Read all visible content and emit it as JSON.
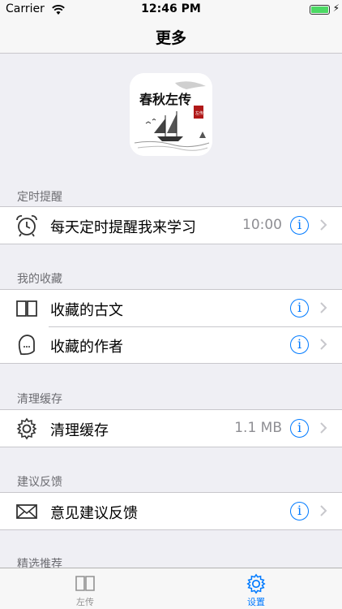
{
  "status": {
    "carrier": "Carrier",
    "time": "12:46 PM"
  },
  "nav": {
    "title": "更多"
  },
  "logo": {
    "text": "春秋左传",
    "stamp": "左传"
  },
  "sections": {
    "reminder": {
      "header": "定时提醒",
      "label": "每天定时提醒我来学习",
      "value": "10:00"
    },
    "favorites": {
      "header": "我的收藏",
      "items": [
        {
          "label": "收藏的古文"
        },
        {
          "label": "收藏的作者"
        }
      ]
    },
    "cache": {
      "header": "清理缓存",
      "label": "清理缓存",
      "value": "1.1 MB"
    },
    "feedback": {
      "header": "建议反馈",
      "label": "意见建议反馈"
    },
    "recommend": {
      "header": "精选推荐"
    }
  },
  "tabs": [
    {
      "label": "左传"
    },
    {
      "label": "设置"
    }
  ],
  "colors": {
    "accent": "#007aff",
    "background": "#efeff4",
    "battery": "#4cd964"
  }
}
